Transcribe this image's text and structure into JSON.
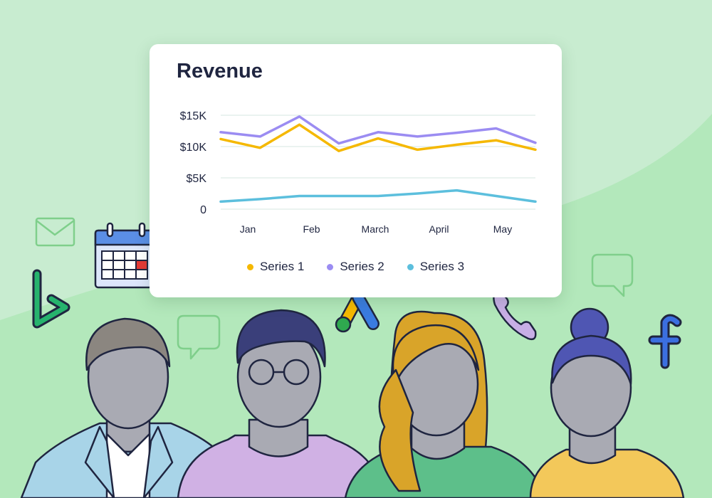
{
  "colors": {
    "background": "#c8ecd0",
    "hill": "#b3e8bb",
    "icon_green": "#7fcf8b",
    "bing_green": "#26b36d",
    "facebook_blue": "#3b6fe0",
    "ads_blue": "#3a7be0",
    "ads_yellow": "#f5b800",
    "ads_green": "#2fa84f",
    "phone_purple": "#c8aee6",
    "calendar_blue": "#5b8ee6",
    "outline": "#1f2540"
  },
  "icons": [
    "mail-icon",
    "calendar-icon",
    "bing-logo-icon",
    "chat-bubble-icon",
    "google-ads-logo-icon",
    "phone-icon",
    "facebook-logo-icon"
  ],
  "people": [
    {
      "name": "person-man-blazer",
      "hair": "#8b8680",
      "shirt": "#a8d4e8"
    },
    {
      "name": "person-man-glasses",
      "hair": "#3a3f7a",
      "shirt": "#d0b1e4"
    },
    {
      "name": "person-woman-long-hair",
      "hair": "#d9a429",
      "shirt": "#5dbf8a"
    },
    {
      "name": "person-woman-bun",
      "hair": "#4f56b3",
      "shirt": "#f3c85a"
    }
  ],
  "chart_data": {
    "type": "line",
    "title": "Revenue",
    "xlabel": "",
    "ylabel": "",
    "ylim": [
      0,
      15000
    ],
    "y_ticks": [
      {
        "value": 0,
        "label": "0"
      },
      {
        "value": 5000,
        "label": "$5K"
      },
      {
        "value": 10000,
        "label": "$10K"
      },
      {
        "value": 15000,
        "label": "$15K"
      }
    ],
    "x_tick_labels": [
      "Jan",
      "Feb",
      "March",
      "April",
      "May"
    ],
    "grid": "horizontal",
    "legend_position": "bottom",
    "series": [
      {
        "name": "Series 1",
        "color": "#f5b800",
        "values": [
          11200,
          9800,
          13500,
          9300,
          11300,
          9500,
          10300,
          11000,
          9500
        ]
      },
      {
        "name": "Series 2",
        "color": "#9b8cf2",
        "values": [
          12300,
          11600,
          14800,
          10500,
          12300,
          11600,
          12200,
          12900,
          10600
        ]
      },
      {
        "name": "Series 3",
        "color": "#5cbfdd",
        "values": [
          1200,
          1600,
          2100,
          2100,
          2100,
          2500,
          3000,
          2100,
          1200
        ]
      }
    ]
  }
}
